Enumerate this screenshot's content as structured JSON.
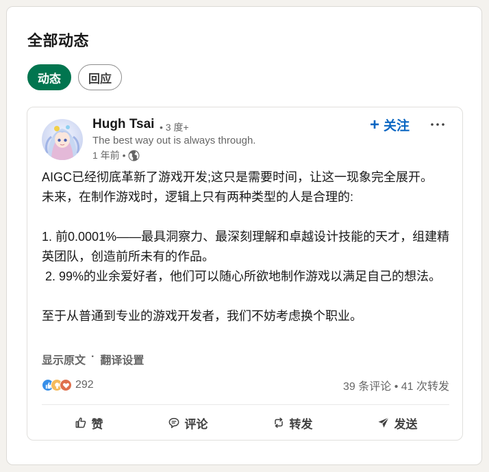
{
  "section": {
    "title": "全部动态"
  },
  "tabs": [
    {
      "label": "动态",
      "active": true
    },
    {
      "label": "回应",
      "active": false
    }
  ],
  "post": {
    "author": {
      "name": "Hugh Tsai",
      "degree": "• 3 度+",
      "headline": "The best way out is always through.",
      "time": "1 年前 •",
      "visibility_icon": "globe-icon"
    },
    "follow_label": "关注",
    "follow_icon": "plus-icon",
    "more_icon": "more-icon",
    "body": [
      "AIGC已经彻底革新了游戏开发;这只是需要时间，让这一现象完全展开。",
      "未来，在制作游戏时，逻辑上只有两种类型的人是合理的:",
      "",
      "1. 前0.0001%——最具洞察力、最深刻理解和卓越设计技能的天才，组建精英团队，创造前所未有的作品。",
      " 2. 99%的业余爱好者，他们可以随心所欲地制作游戏以满足自己的想法。",
      "",
      "至于从普通到专业的游戏开发者，我们不妨考虑换个职业。"
    ],
    "show_original": "显示原文",
    "separator": "·",
    "translate_settings": "翻译设置",
    "reactions": {
      "icons": [
        "like-icon",
        "insightful-icon",
        "love-icon"
      ],
      "count": "292"
    },
    "stats": "39 条评论 • 41 次转发",
    "actions": [
      {
        "label": "赞",
        "icon": "thumbs-up-icon"
      },
      {
        "label": "评论",
        "icon": "comment-icon"
      },
      {
        "label": "转发",
        "icon": "repost-icon"
      },
      {
        "label": "发送",
        "icon": "send-icon"
      }
    ]
  },
  "colors": {
    "accent_green": "#01754f",
    "link_blue": "#0a66c2",
    "text_primary": "#191919",
    "text_secondary": "#666666"
  }
}
